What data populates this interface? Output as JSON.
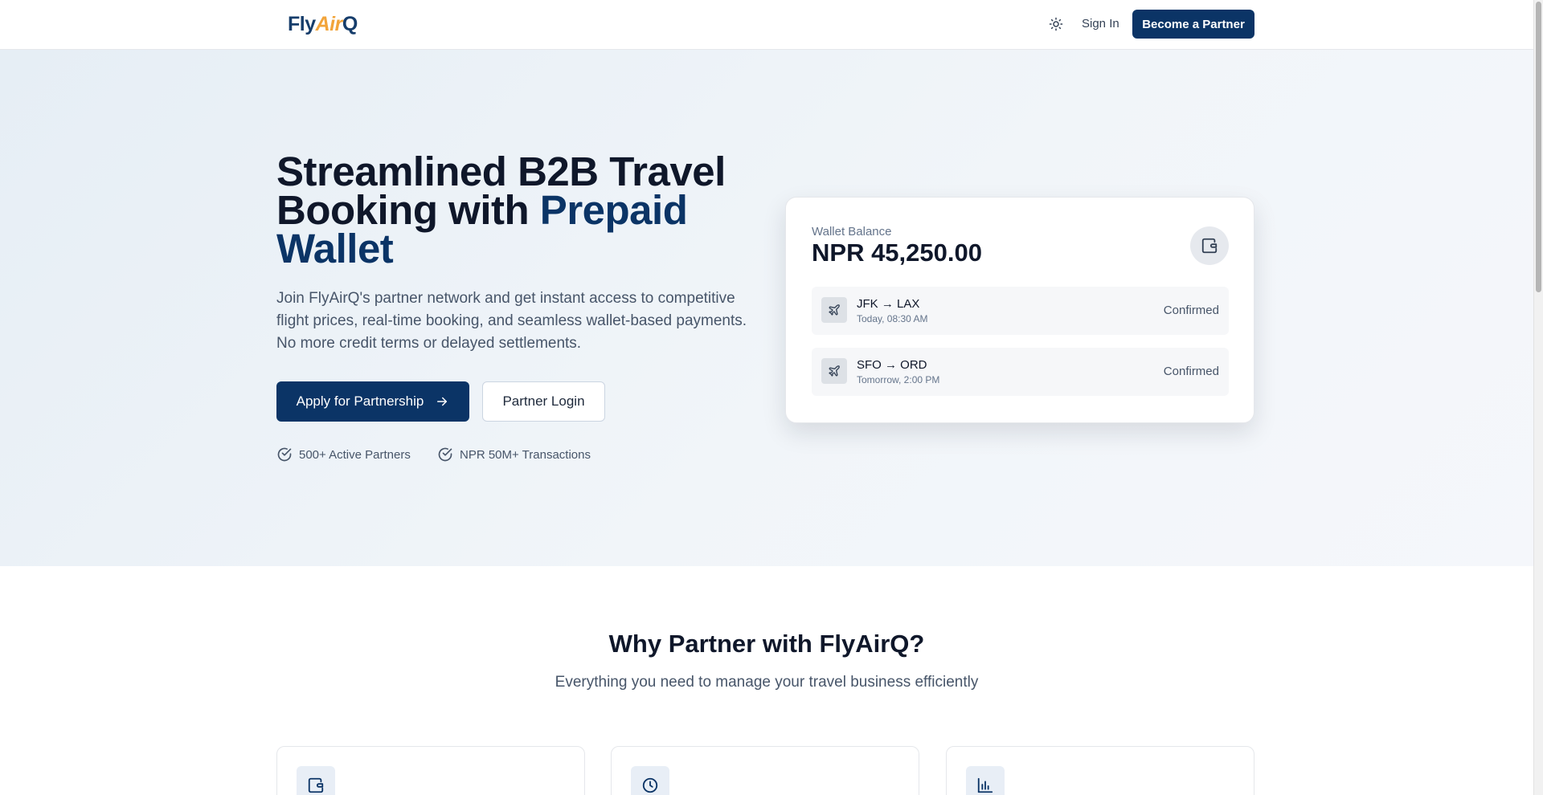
{
  "header": {
    "logo": {
      "part1": "Fly",
      "part2": "Air",
      "part3": "Q"
    },
    "theme_icon": "sun-icon",
    "signin_label": "Sign In",
    "partner_button": "Become a Partner"
  },
  "hero": {
    "title_line1": "Streamlined B2B Travel",
    "title_line2_plain": "Booking with ",
    "title_line2_accent": "Prepaid",
    "title_line3_accent": "Wallet",
    "description": "Join FlyAirQ's partner network and get instant access to competitive flight prices, real-time booking, and seamless wallet-based payments. No more credit terms or delayed settlements.",
    "apply_button": "Apply for Partnership",
    "login_button": "Partner Login",
    "stats": [
      "500+ Active Partners",
      "NPR 50M+ Transactions"
    ]
  },
  "wallet": {
    "label": "Wallet Balance",
    "amount": "NPR 45,250.00",
    "flights": [
      {
        "route": "JFK → LAX",
        "time": "Today, 08:30 AM",
        "status": "Confirmed"
      },
      {
        "route": "SFO → ORD",
        "time": "Tomorrow, 2:00 PM",
        "status": "Confirmed"
      }
    ]
  },
  "why": {
    "title": "Why Partner with FlyAirQ?",
    "subtitle": "Everything you need to manage your travel business efficiently",
    "feature_icons": [
      "wallet-icon",
      "clock-icon",
      "bar-chart-icon"
    ]
  },
  "colors": {
    "brand_navy": "#0b3466",
    "logo_orange": "#f2a43a",
    "hero_bg": "#eef3f8"
  }
}
